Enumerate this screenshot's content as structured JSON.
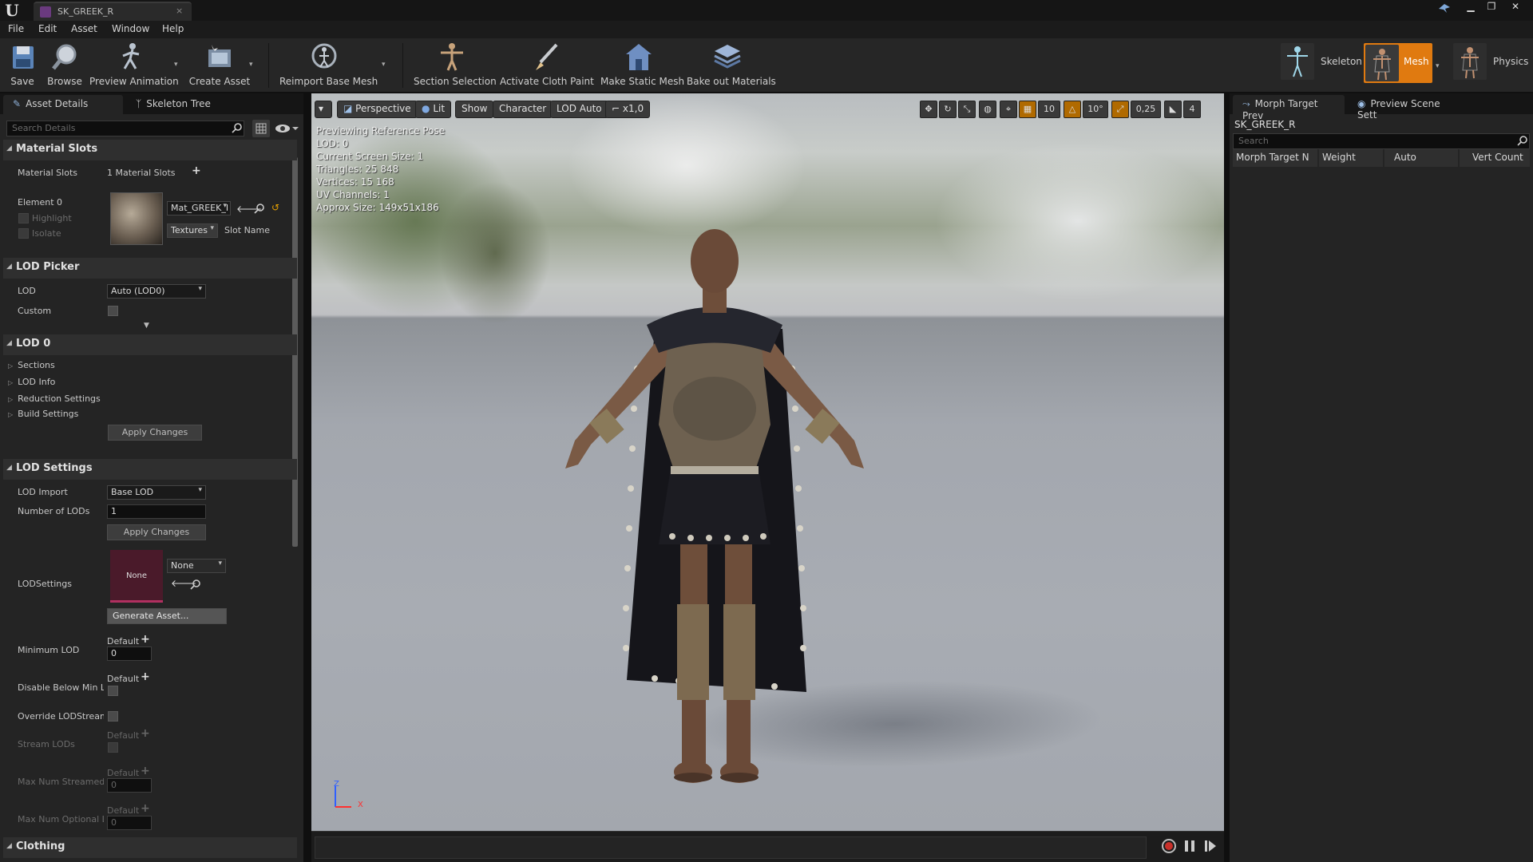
{
  "window": {
    "tab_title": "SK_GREEK_R",
    "tab_close": "×",
    "controls": {
      "minimize": "▁",
      "restore": "❐",
      "close": "✕"
    }
  },
  "menu": [
    "File",
    "Edit",
    "Asset",
    "Window",
    "Help"
  ],
  "toolbar": {
    "save": "Save",
    "browse": "Browse",
    "preview_animation": "Preview Animation",
    "create_asset": "Create Asset",
    "reimport_base_mesh": "Reimport Base Mesh",
    "section_selection": "Section Selection",
    "activate_cloth_paint": "Activate Cloth Paint",
    "make_static_mesh": "Make Static Mesh",
    "bake_out_materials": "Bake out Materials",
    "dropdown_caret": "▾"
  },
  "modes": {
    "skeleton": "Skeleton",
    "mesh": "Mesh",
    "physics": "Physics",
    "active": "mesh"
  },
  "left_panel": {
    "tabs": [
      "Asset Details",
      "Skeleton Tree"
    ],
    "search_placeholder": "Search Details",
    "material_slots": {
      "header": "Material Slots",
      "label": "Material Slots",
      "value": "1 Material Slots",
      "element_label": "Element 0",
      "highlight": "Highlight",
      "isolate": "Isolate",
      "material_name": "Mat_GREEK_I",
      "textures": "Textures",
      "slot_name": "Slot Name"
    },
    "lod_picker": {
      "header": "LOD Picker",
      "lod_label": "LOD",
      "lod_value": "Auto (LOD0)",
      "custom_label": "Custom"
    },
    "lod0": {
      "header": "LOD 0",
      "items": [
        "Sections",
        "LOD Info",
        "Reduction Settings",
        "Build Settings"
      ],
      "apply_changes": "Apply Changes"
    },
    "lod_settings": {
      "header": "LOD Settings",
      "lod_import_label": "LOD Import",
      "lod_import_value": "Base LOD",
      "num_lods_label": "Number of LODs",
      "num_lods_value": "1",
      "apply_changes": "Apply Changes",
      "lodsettings_label": "LODSettings",
      "lodsettings_thumb": "None",
      "lodsettings_value": "None",
      "generate_asset": "Generate Asset...",
      "minimum_lod_label": "Minimum LOD",
      "default_label": "Default",
      "minimum_lod_value": "0",
      "disable_below_min_label": "Disable Below Min Lo",
      "override_stream_label": "Override LODStreami",
      "stream_lods_label": "Stream LODs",
      "max_num_streamed_label": "Max Num Streamed",
      "max_num_streamed_value": "0",
      "max_num_optional_label": "Max Num Optional LO",
      "max_num_optional_value": "0"
    },
    "clothing": {
      "header": "Clothing"
    }
  },
  "viewport": {
    "buttons": {
      "perspective": "Perspective",
      "lit": "Lit",
      "show": "Show",
      "character": "Character",
      "lod_auto": "LOD Auto",
      "speed": "x1,0"
    },
    "right_values": {
      "grid_snap": "10",
      "rotation_snap": "10°",
      "scale_snap": "0,25",
      "camera_speed": "4"
    },
    "info_lines": [
      "Previewing Reference Pose",
      "LOD: 0",
      "Current Screen Size: 1",
      "Triangles: 25 848",
      "Vertices: 15 168",
      "UV Channels: 1",
      "Approx Size: 149x51x186"
    ],
    "axis": {
      "z": "Z",
      "x": "X"
    }
  },
  "right_panel": {
    "tabs": [
      "Morph Target Prev",
      "Preview Scene Sett"
    ],
    "asset_name": "SK_GREEK_R",
    "search_placeholder": "Search",
    "columns": [
      "Morph Target N",
      "Weight",
      "Auto",
      "Vert Count"
    ]
  },
  "colors": {
    "accent_orange": "#e58a00",
    "mesh_active": "#e07a10",
    "viewport_floor": "#a5a9b0"
  }
}
